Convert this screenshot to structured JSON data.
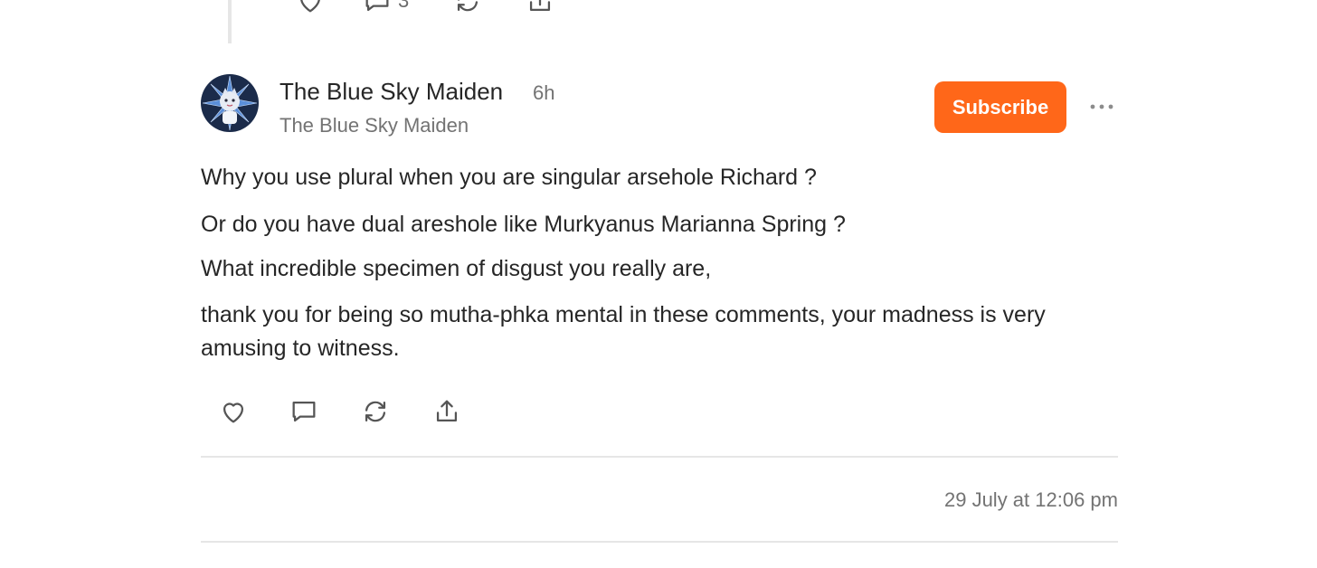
{
  "colors": {
    "accent": "#ff6719",
    "text": "#262626",
    "muted": "#737373",
    "divider": "#e6e6e6"
  },
  "previous_comment": {
    "actions": [
      {
        "icon": "heart-icon"
      },
      {
        "icon": "comment-icon",
        "count": "3"
      },
      {
        "icon": "restack-icon"
      },
      {
        "icon": "share-icon"
      }
    ]
  },
  "comment": {
    "author": "The Blue Sky Maiden",
    "time": "6h",
    "handle": "The Blue Sky Maiden",
    "subscribe_label": "Subscribe",
    "more_icon": "more-icon",
    "paragraphs": [
      "Why you use plural when you are singular arsehole Richard ?",
      "Or do you have dual areshole like Murkyanus Marianna Spring ?",
      "What incredible specimen of disgust you really are,",
      "thank you for being so mutha-phka mental in these comments, your madness is very amusing to witness."
    ],
    "actions": [
      "heart-icon",
      "comment-icon",
      "restack-icon",
      "share-icon"
    ],
    "timestamp": "29 July at 12:06 pm"
  }
}
